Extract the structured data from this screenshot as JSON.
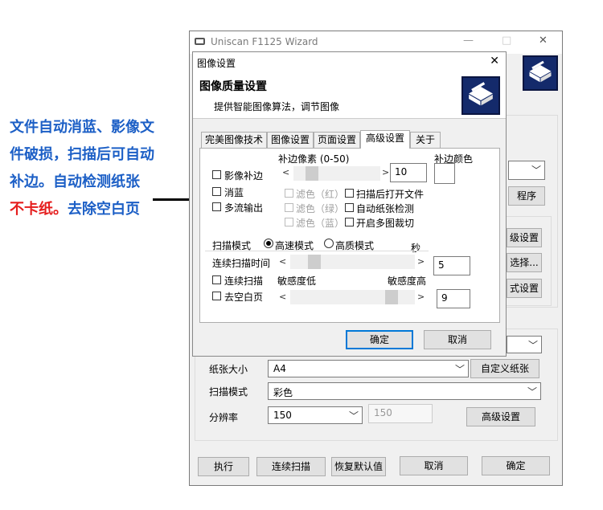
{
  "annotation": {
    "lines": [
      {
        "text": "文件自动消蓝、影像文",
        "color": "blue"
      },
      {
        "text": "件破损，扫描后可自动",
        "color": "blue"
      },
      {
        "text": "补边。自动检测纸张",
        "color": "blue"
      },
      {
        "text": "不卡纸。",
        "color": "red",
        "tail": "去除空白页"
      }
    ]
  },
  "window": {
    "title": "Uniscan F1125 Wizard",
    "controls": {
      "minimize": "—",
      "maximize": "□",
      "close": "✕"
    },
    "right_buttons": [
      "程序",
      "级设置",
      "选择...",
      "式设置"
    ],
    "rows": [
      {
        "label": "纸张大小",
        "value": "A4",
        "button": "自定义纸张"
      },
      {
        "label": "扫描模式",
        "value": "彩色"
      },
      {
        "label": "分辨率",
        "value": "150",
        "extra": "150",
        "button": "高级设置"
      }
    ],
    "bottom_buttons": [
      "执行",
      "连续扫描",
      "恢复默认值",
      "取消",
      "确定"
    ]
  },
  "dialog": {
    "title": "图像设置",
    "close": "✕",
    "header": {
      "title": "图像质量设置",
      "subtitle": "提供智能图像算法，调节图像"
    },
    "tabs": [
      "完美图像技术",
      "图像设置",
      "页面设置",
      "高级设置",
      "关于"
    ],
    "selected_tab": "高级设置",
    "advanced": {
      "fill_pixel_label": "补边像素 (0-50)",
      "fill_color_label": "补边颜色",
      "fill_pixel_value": "10",
      "image_fill": "影像补边",
      "remove_blue": "消蓝",
      "multi_stream": "多流输出",
      "filter_red": "滤色（红）",
      "filter_green": "滤色（绿）",
      "filter_blue": "滤色（蓝）",
      "open_after_scan": "扫描后打开文件",
      "auto_paper_detect": "自动纸张检测",
      "multi_crop": "开启多图裁切",
      "scan_mode_label": "扫描模式",
      "fast_mode": "高速模式",
      "quality_mode": "高质模式",
      "scan_mode_selected": "高速模式",
      "seconds_label": "秒",
      "continuous_time_label": "连续扫描时间",
      "continuous_time_value": "5",
      "continuous_scan": "连续扫描",
      "remove_blank": "去空白页",
      "sensitivity_low": "敏感度低",
      "sensitivity_high": "敏感度高",
      "sensitivity_value": "9"
    },
    "ok": "确定",
    "cancel": "取消"
  }
}
